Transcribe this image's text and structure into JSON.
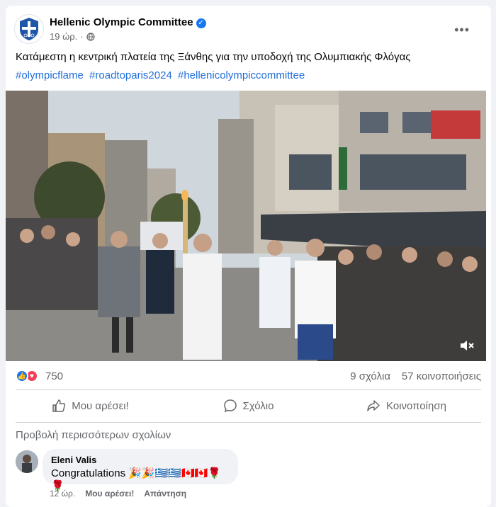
{
  "post": {
    "page_name": "Hellenic Olympic Committee",
    "time": "19 ώρ.",
    "separator": "·",
    "text": "Κατάμεστη η κεντρική πλατεία της Ξάνθης για την υποδοχή της Ολυμπιακής Φλόγας",
    "hashtags": [
      "#olympicflame",
      "#roadtoparis2024",
      "#hellenicolympiccommittee"
    ]
  },
  "stats": {
    "reactions": "750",
    "comments": "9 σχόλια",
    "shares": "57 κοινοποιήσεις"
  },
  "actions": {
    "like": "Μου αρέσει!",
    "comment": "Σχόλιο",
    "share": "Κοινοποίηση"
  },
  "comments_section": {
    "view_more": "Προβολή περισσότερων σχολίων",
    "comment": {
      "author": "Eleni Valis",
      "text": "Congratulations 🎉🎉🇬🇷🇬🇷🇨🇦🇨🇦🌹🌹",
      "time": "12 ώρ.",
      "like": "Μου αρέσει!",
      "reply": "Απάντηση"
    }
  },
  "colors": {
    "brand_blue": "#1877f2",
    "link_blue": "#216fdb",
    "muted_text": "#65676b",
    "love_red": "#f33e58"
  }
}
